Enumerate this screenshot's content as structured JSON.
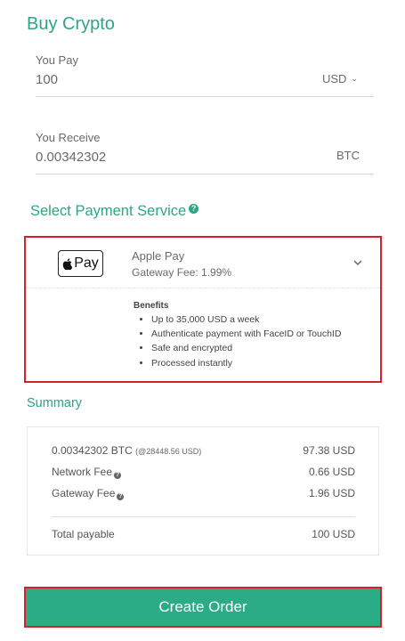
{
  "page": {
    "title": "Buy Crypto"
  },
  "you_pay": {
    "label": "You Pay",
    "value": "100",
    "currency": "USD"
  },
  "you_receive": {
    "label": "You Receive",
    "value": "0.00342302",
    "currency": "BTC"
  },
  "payment": {
    "section_title": "Select Payment Service",
    "selected": {
      "logo_text": "Pay",
      "name": "Apple Pay",
      "fee": "Gateway Fee: 1.99%"
    },
    "benefits_title": "Benefits",
    "benefits": [
      "Up to 35,000 USD a week",
      "Authenticate payment with FaceID or TouchID",
      "Safe and encrypted",
      "Processed instantly"
    ]
  },
  "summary": {
    "title": "Summary",
    "btc_amount": "0.00342302 BTC",
    "btc_rate": "(@28448.56 USD)",
    "btc_value": "97.38 USD",
    "network_fee_label": "Network Fee",
    "network_fee_value": "0.66 USD",
    "gateway_fee_label": "Gateway Fee",
    "gateway_fee_value": "1.96 USD",
    "total_label": "Total payable",
    "total_value": "100 USD"
  },
  "actions": {
    "create_order": "Create Order"
  },
  "colors": {
    "accent": "#2ba684",
    "button": "#2bac87",
    "highlight": "#d6212a"
  },
  "icons": {
    "currency_dropdown": "chevron-down-icon",
    "payment_expand": "chevron-down-icon",
    "help": "question-icon",
    "apple": "apple-logo-icon"
  }
}
